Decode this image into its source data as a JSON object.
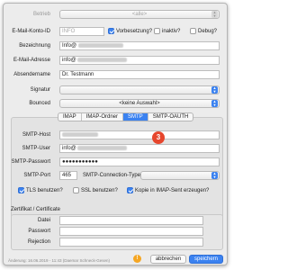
{
  "form": {
    "betrieb_label": "Betrieb",
    "betrieb_value": "<alle>",
    "email_konto_id_label": "E-Mail-Konto-ID",
    "email_konto_id_placeholder": "INFO",
    "vorbesetzung_label": "Vorbesetzung?",
    "vorbesetzung_checked": true,
    "inaktiv_label": "inaktiv?",
    "inaktiv_checked": false,
    "debug_label": "Debug?",
    "debug_checked": false,
    "bezeichnung_label": "Bezeichnung",
    "bezeichnung_value": "Info@",
    "email_adresse_label": "E-Mail-Adresse",
    "email_adresse_value": "info@",
    "absendername_label": "Absendername",
    "absendername_value": "Dr. Testmann",
    "signatur_label": "Signatur",
    "bounced_label": "Bounced",
    "bounced_value": "<keine Auswahl>"
  },
  "tabs": [
    {
      "label": "IMAP",
      "selected": false
    },
    {
      "label": "IMAP-Ordner",
      "selected": false
    },
    {
      "label": "SMTP",
      "selected": true
    },
    {
      "label": "SMTP-OAUTH",
      "selected": false
    }
  ],
  "smtp": {
    "host_label": "SMTP-Host",
    "user_label": "SMTP-User",
    "user_value": "info@",
    "password_label": "SMTP-Passwort",
    "password_value": "●●●●●●●●●●●",
    "port_label": "SMTP-Port",
    "port_value": "465",
    "connection_type_label": "SMTP-Connection-Type",
    "tls_label": "TLS benutzen?",
    "tls_checked": true,
    "ssl_label": "SSL benutzen?",
    "ssl_checked": false,
    "copy_imap_label": "Kopie in IMAP-Sent erzeugen?",
    "copy_imap_checked": true
  },
  "annotation_badge": "3",
  "certificate": {
    "group_label": "Zertifikat / Certificate",
    "datei_label": "Datei",
    "passwort_label": "Passwort",
    "rejection_label": "Rejection"
  },
  "footer": {
    "change_info": "Änderung: 16.06.2019 - 11:43 (Daemar Schneck-Gesen)",
    "warning_icon_glyph": "!",
    "cancel_label": "abbrechen",
    "save_label": "speichern"
  },
  "colors": {
    "accent": "#3b82f0",
    "badge": "#e6462d",
    "warning": "#f5a623"
  }
}
